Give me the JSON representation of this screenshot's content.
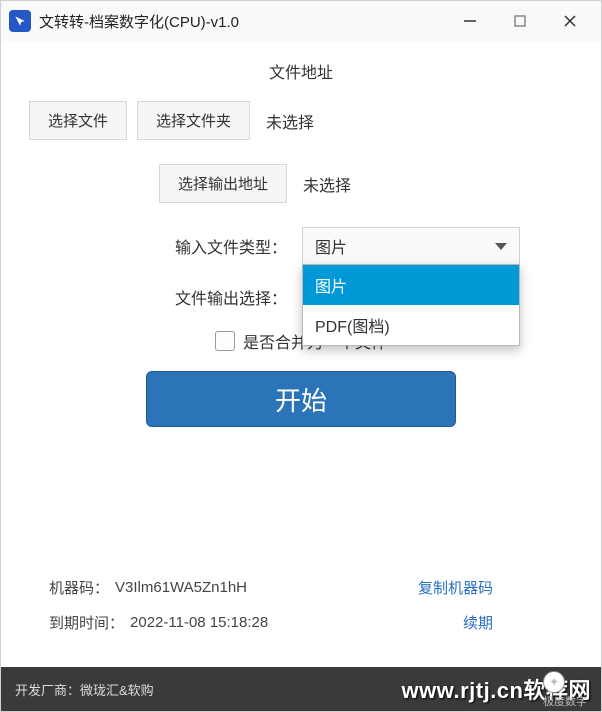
{
  "window": {
    "title": "文转转-档案数字化(CPU)-v1.0"
  },
  "labels": {
    "file_address": "文件地址",
    "select_file": "选择文件",
    "select_folder": "选择文件夹",
    "not_selected_file": "未选择",
    "select_output": "选择输出地址",
    "not_selected_output": "未选择",
    "input_file_type": "输入文件类型：",
    "file_output_select": "文件输出选择：",
    "merge_checkbox": "是否合并为一个文件",
    "start": "开始"
  },
  "dropdown": {
    "selected_input": "图片",
    "options": [
      "图片",
      "PDF(图档)"
    ]
  },
  "info": {
    "machine_label": "机器码：",
    "machine_value": "V3Ilm61WA5Zn1hH",
    "copy_machine": "复制机器码",
    "expire_label": "到期时间：",
    "expire_value": "2022-11-08 15:18:28",
    "renew": "续期"
  },
  "footer": {
    "vendor": "开发厂商：微珑汇&软购",
    "overlay": "www.rjtj.cn软荐网",
    "sub": "极度数字"
  }
}
